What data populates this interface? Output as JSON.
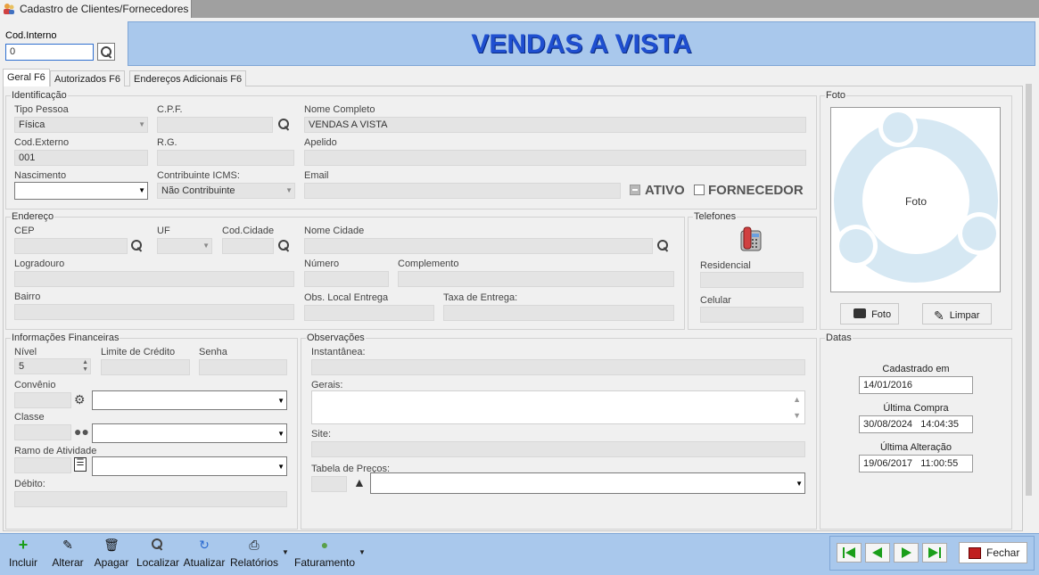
{
  "window": {
    "title": "Cadastro de Clientes/Fornecedores"
  },
  "header": {
    "cod_interno_label": "Cod.Interno",
    "cod_interno_value": "0",
    "banner": "VENDAS A VISTA"
  },
  "tabs": [
    "Geral F6",
    "Autorizados F6",
    "Endereços Adicionais F6"
  ],
  "identificacao": {
    "group": "Identificação",
    "tipo_pessoa_label": "Tipo Pessoa",
    "tipo_pessoa_value": "Física",
    "cpf_label": "C.P.F.",
    "nome_label": "Nome Completo",
    "nome_value": "VENDAS A VISTA",
    "cod_externo_label": "Cod.Externo",
    "cod_externo_value": "001",
    "rg_label": "R.G.",
    "apelido_label": "Apelido",
    "nascimento_label": "Nascimento",
    "icms_label": "Contribuinte ICMS:",
    "icms_value": "Não Contribuinte",
    "email_label": "Email",
    "ativo_label": "ATIVO",
    "fornecedor_label": "FORNECEDOR"
  },
  "endereco": {
    "group": "Endereço",
    "cep_label": "CEP",
    "uf_label": "UF",
    "cod_cidade_label": "Cod.Cidade",
    "nome_cidade_label": "Nome Cidade",
    "logradouro_label": "Logradouro",
    "numero_label": "Número",
    "complemento_label": "Complemento",
    "bairro_label": "Bairro",
    "obs_label": "Obs. Local Entrega",
    "taxa_label": "Taxa de Entrega:"
  },
  "telefones": {
    "group": "Telefones",
    "residencial_label": "Residencial",
    "celular_label": "Celular"
  },
  "foto": {
    "group": "Foto",
    "placeholder": "Foto",
    "foto_button": "Foto",
    "limpar_button": "Limpar"
  },
  "financeiras": {
    "group": "Informações Financeiras",
    "nivel_label": "Nível",
    "nivel_value": "5",
    "limite_label": "Limite de Crédito",
    "senha_label": "Senha",
    "convenio_label": "Convênio",
    "classe_label": "Classe",
    "ramo_label": "Ramo de Atividade",
    "debito_label": "Débito:"
  },
  "observacoes": {
    "group": "Observações",
    "instantanea_label": "Instantânea:",
    "gerais_label": "Gerais:",
    "site_label": "Site:",
    "tabela_label": "Tabela de Preços:"
  },
  "datas": {
    "group": "Datas",
    "cadastrado_label": "Cadastrado em",
    "cadastrado_value": "14/01/2016",
    "ultima_compra_label": "Última Compra",
    "ultima_compra_value": "30/08/2024   14:04:35",
    "ultima_alteracao_label": "Última Alteração",
    "ultima_alteracao_value": "19/06/2017   11:00:55"
  },
  "toolbar": {
    "incluir": "Incluir",
    "alterar": "Alterar",
    "apagar": "Apagar",
    "localizar": "Localizar",
    "atualizar": "Atualizar",
    "relatorios": "Relatórios",
    "faturamento": "Faturamento",
    "fechar": "Fechar"
  },
  "colors": {
    "banner_bg": "#a9c8ec",
    "banner_text": "#1f4fd0",
    "toolbar_bg": "#a9c8ec",
    "nav_green": "#1a9e1a"
  }
}
